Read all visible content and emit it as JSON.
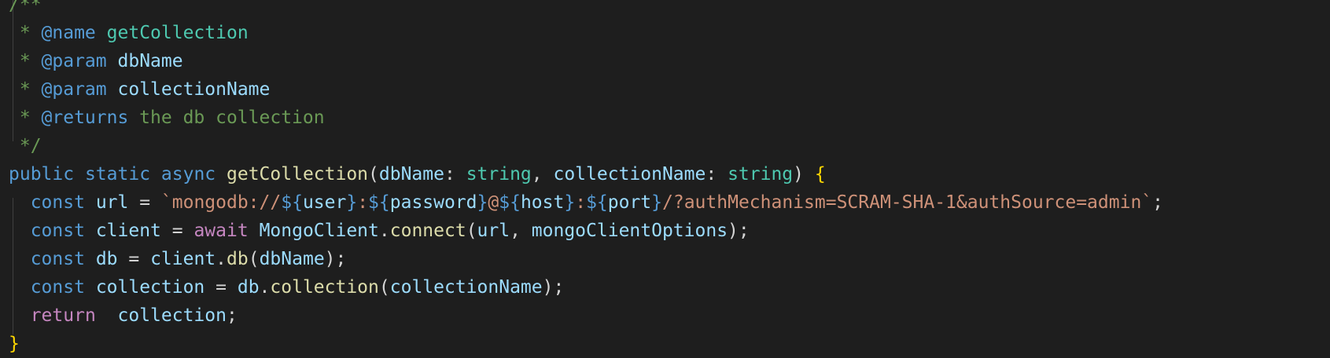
{
  "code": {
    "lines": [
      [
        {
          "t": "/**",
          "c": "comment"
        }
      ],
      [
        {
          "t": " * ",
          "c": "comment"
        },
        {
          "t": "@name",
          "c": "doc-tag"
        },
        {
          "t": " ",
          "c": "comment"
        },
        {
          "t": "getCollection",
          "c": "doc-type"
        }
      ],
      [
        {
          "t": " * ",
          "c": "comment"
        },
        {
          "t": "@param",
          "c": "doc-tag"
        },
        {
          "t": " ",
          "c": "comment"
        },
        {
          "t": "dbName",
          "c": "doc-param"
        }
      ],
      [
        {
          "t": " * ",
          "c": "comment"
        },
        {
          "t": "@param",
          "c": "doc-tag"
        },
        {
          "t": " ",
          "c": "comment"
        },
        {
          "t": "collectionName",
          "c": "doc-param"
        }
      ],
      [
        {
          "t": " * ",
          "c": "comment"
        },
        {
          "t": "@returns",
          "c": "doc-tag"
        },
        {
          "t": " the db collection",
          "c": "comment"
        }
      ],
      [
        {
          "t": " */",
          "c": "comment"
        }
      ],
      [
        {
          "t": "public",
          "c": "kw"
        },
        {
          "t": " ",
          "c": "punc"
        },
        {
          "t": "static",
          "c": "kw"
        },
        {
          "t": " ",
          "c": "punc"
        },
        {
          "t": "async",
          "c": "kw"
        },
        {
          "t": " ",
          "c": "punc"
        },
        {
          "t": "getCollection",
          "c": "fn"
        },
        {
          "t": "(",
          "c": "punc"
        },
        {
          "t": "dbName",
          "c": "var"
        },
        {
          "t": ": ",
          "c": "punc"
        },
        {
          "t": "string",
          "c": "type"
        },
        {
          "t": ", ",
          "c": "punc"
        },
        {
          "t": "collectionName",
          "c": "var"
        },
        {
          "t": ": ",
          "c": "punc"
        },
        {
          "t": "string",
          "c": "type"
        },
        {
          "t": ") ",
          "c": "punc"
        },
        {
          "t": "{",
          "c": "brace"
        }
      ],
      [
        {
          "t": "  ",
          "c": "punc"
        },
        {
          "t": "const",
          "c": "kw"
        },
        {
          "t": " ",
          "c": "punc"
        },
        {
          "t": "url",
          "c": "var"
        },
        {
          "t": " = ",
          "c": "punc"
        },
        {
          "t": "`mongodb://",
          "c": "str"
        },
        {
          "t": "${",
          "c": "tmpl"
        },
        {
          "t": "user",
          "c": "var"
        },
        {
          "t": "}",
          "c": "tmpl"
        },
        {
          "t": ":",
          "c": "str"
        },
        {
          "t": "${",
          "c": "tmpl"
        },
        {
          "t": "password",
          "c": "var"
        },
        {
          "t": "}",
          "c": "tmpl"
        },
        {
          "t": "@",
          "c": "str"
        },
        {
          "t": "${",
          "c": "tmpl"
        },
        {
          "t": "host",
          "c": "var"
        },
        {
          "t": "}",
          "c": "tmpl"
        },
        {
          "t": ":",
          "c": "str"
        },
        {
          "t": "${",
          "c": "tmpl"
        },
        {
          "t": "port",
          "c": "var"
        },
        {
          "t": "}",
          "c": "tmpl"
        },
        {
          "t": "/?authMechanism=SCRAM-SHA-1&authSource=admin`",
          "c": "str"
        },
        {
          "t": ";",
          "c": "punc"
        }
      ],
      [
        {
          "t": "  ",
          "c": "punc"
        },
        {
          "t": "const",
          "c": "kw"
        },
        {
          "t": " ",
          "c": "punc"
        },
        {
          "t": "client",
          "c": "var"
        },
        {
          "t": " = ",
          "c": "punc"
        },
        {
          "t": "await",
          "c": "ctrl"
        },
        {
          "t": " ",
          "c": "punc"
        },
        {
          "t": "MongoClient",
          "c": "var"
        },
        {
          "t": ".",
          "c": "punc"
        },
        {
          "t": "connect",
          "c": "fn"
        },
        {
          "t": "(",
          "c": "punc"
        },
        {
          "t": "url",
          "c": "var"
        },
        {
          "t": ", ",
          "c": "punc"
        },
        {
          "t": "mongoClientOptions",
          "c": "var"
        },
        {
          "t": ");",
          "c": "punc"
        }
      ],
      [
        {
          "t": "  ",
          "c": "punc"
        },
        {
          "t": "const",
          "c": "kw"
        },
        {
          "t": " ",
          "c": "punc"
        },
        {
          "t": "db",
          "c": "var"
        },
        {
          "t": " = ",
          "c": "punc"
        },
        {
          "t": "client",
          "c": "var"
        },
        {
          "t": ".",
          "c": "punc"
        },
        {
          "t": "db",
          "c": "fn"
        },
        {
          "t": "(",
          "c": "punc"
        },
        {
          "t": "dbName",
          "c": "var"
        },
        {
          "t": ");",
          "c": "punc"
        }
      ],
      [
        {
          "t": "  ",
          "c": "punc"
        },
        {
          "t": "const",
          "c": "kw"
        },
        {
          "t": " ",
          "c": "punc"
        },
        {
          "t": "collection",
          "c": "var"
        },
        {
          "t": " = ",
          "c": "punc"
        },
        {
          "t": "db",
          "c": "var"
        },
        {
          "t": ".",
          "c": "punc"
        },
        {
          "t": "collection",
          "c": "fn"
        },
        {
          "t": "(",
          "c": "punc"
        },
        {
          "t": "collectionName",
          "c": "var"
        },
        {
          "t": ");",
          "c": "punc"
        }
      ],
      [
        {
          "t": "  ",
          "c": "punc"
        },
        {
          "t": "return",
          "c": "ctrl"
        },
        {
          "t": "  ",
          "c": "punc"
        },
        {
          "t": "collection",
          "c": "var"
        },
        {
          "t": ";",
          "c": "punc"
        }
      ],
      [
        {
          "t": "}",
          "c": "brace"
        }
      ]
    ]
  },
  "colors": {
    "background": "#1e1e1e",
    "comment": "#6a9955",
    "keyword": "#569cd6",
    "control": "#c586c0",
    "function": "#dcdcaa",
    "variable": "#9cdcfe",
    "type": "#4ec9b0",
    "string": "#ce9178",
    "brace": "#ffd700"
  }
}
